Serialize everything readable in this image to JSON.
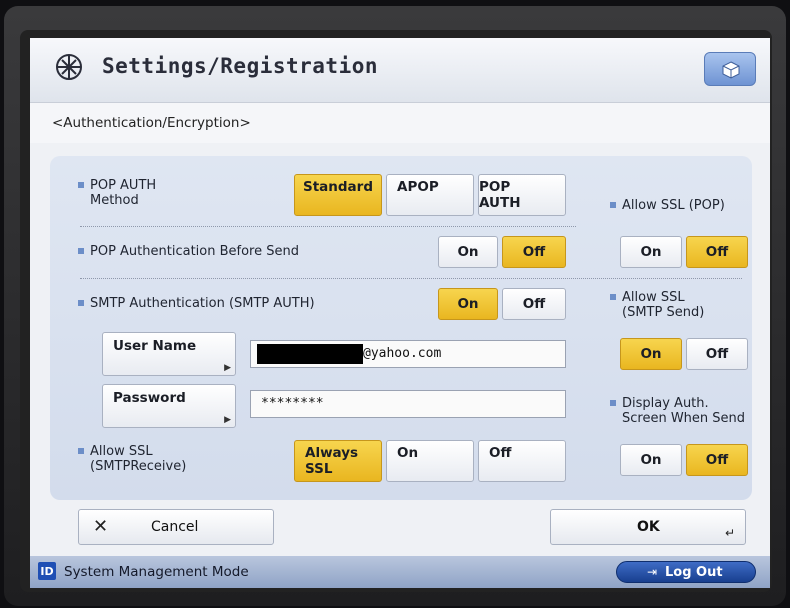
{
  "header": {
    "title": "Settings/Registration",
    "breadcrumb": "<Authentication/Encryption>"
  },
  "pop_auth_method": {
    "label": "POP AUTH\nMethod",
    "options": [
      "Standard",
      "APOP",
      "POP AUTH"
    ],
    "selected": "Standard"
  },
  "pop_before_send": {
    "label": "POP Authentication Before Send",
    "on": "On",
    "off": "Off",
    "selected": "Off"
  },
  "smtp_auth": {
    "label": "SMTP Authentication (SMTP AUTH)",
    "on": "On",
    "off": "Off",
    "selected": "On"
  },
  "user_name": {
    "button_label": "User Name",
    "value": "@yahoo.com"
  },
  "password": {
    "button_label": "Password",
    "value": "********"
  },
  "allow_ssl_smtp_receive": {
    "label": "Allow SSL\n(SMTPReceive)",
    "options": [
      "Always\nSSL",
      "On",
      "Off"
    ],
    "selected": "Always SSL"
  },
  "allow_ssl_pop": {
    "label": "Allow SSL (POP)",
    "on": "On",
    "off": "Off",
    "selected": "Off"
  },
  "allow_ssl_smtp_send": {
    "label": "Allow SSL\n(SMTP Send)",
    "on": "On",
    "off": "Off",
    "selected": "On"
  },
  "display_auth": {
    "label": "Display Auth.\nScreen When Send",
    "on": "On",
    "off": "Off",
    "selected": "Off"
  },
  "actions": {
    "cancel": "Cancel",
    "ok": "OK"
  },
  "footer": {
    "mode_icon": "ID",
    "mode": "System Management Mode",
    "logout": "Log Out"
  },
  "colors": {
    "selected": "#f0c533",
    "panel": "#d9e1ef",
    "footer": "#a4b4d2"
  }
}
